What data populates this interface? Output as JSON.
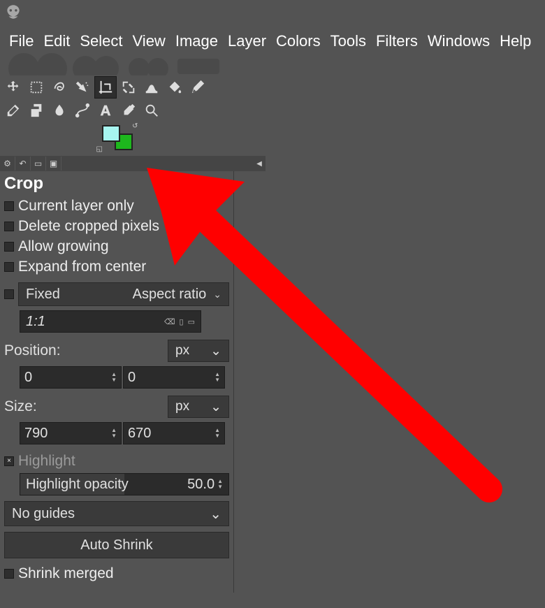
{
  "menu": {
    "items": [
      "File",
      "Edit",
      "Select",
      "View",
      "Image",
      "Layer",
      "Colors",
      "Tools",
      "Filters",
      "Windows",
      "Help"
    ]
  },
  "tools": {
    "row1": [
      "move",
      "rect-select",
      "free-select",
      "fuzzy-select",
      "crop",
      "transform",
      "warp",
      "bucket",
      "pencil",
      "eraser"
    ],
    "row2": [
      "clone",
      "smudge",
      "path",
      "text",
      "picker",
      "zoom"
    ],
    "active": "crop"
  },
  "colors": {
    "fg": "#a7f5f0",
    "bg": "#1db81d"
  },
  "tool_options": {
    "title": "Crop",
    "current_layer_only": {
      "label": "Current layer only",
      "checked": false
    },
    "delete_cropped": {
      "label": "Delete cropped pixels",
      "checked": false
    },
    "allow_growing": {
      "label": "Allow growing",
      "checked": false
    },
    "expand_from_center": {
      "label": "Expand from center",
      "checked": false
    },
    "fixed": {
      "enabled": false,
      "label": "Fixed",
      "mode": "Aspect ratio",
      "value": "1:1"
    },
    "position": {
      "label": "Position:",
      "unit": "px",
      "x": "0",
      "y": "0"
    },
    "size": {
      "label": "Size:",
      "unit": "px",
      "w": "790",
      "h": "670"
    },
    "highlight": {
      "checked": true,
      "label": "Highlight",
      "opacity_label": "Highlight opacity",
      "opacity": "50.0"
    },
    "guides": {
      "value": "No guides"
    },
    "auto_shrink": "Auto Shrink",
    "shrink_merged": {
      "label": "Shrink merged",
      "checked": false
    }
  }
}
